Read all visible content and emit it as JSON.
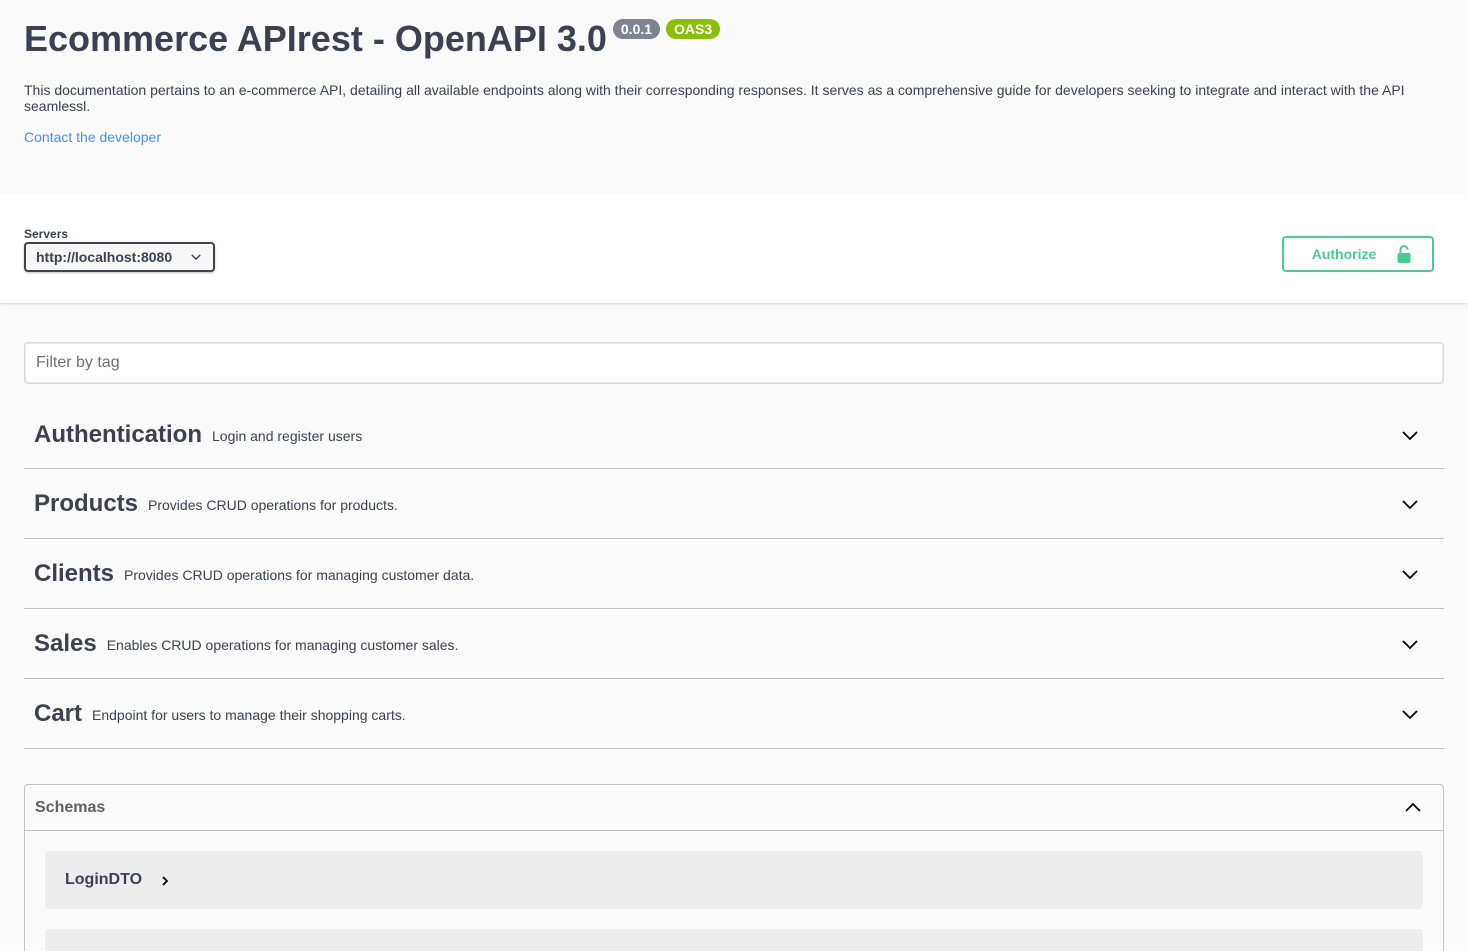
{
  "info": {
    "title": "Ecommerce APIrest - OpenAPI 3.0",
    "version": "0.0.1",
    "oas_badge": "OAS3",
    "description": "This documentation pertains to an e-commerce API, detailing all available endpoints along with their corresponding responses. It serves as a comprehensive guide for developers seeking to integrate and interact with the API seamlessl.",
    "contact_link": "Contact the developer"
  },
  "servers": {
    "label": "Servers",
    "selected": "http://localhost:8080"
  },
  "authorize": {
    "label": "Authorize",
    "icon": "lock-open-icon"
  },
  "filter": {
    "placeholder": "Filter by tag",
    "value": ""
  },
  "tags": [
    {
      "name": "Authentication",
      "description": "Login and register users"
    },
    {
      "name": "Products",
      "description": "Provides CRUD operations for products."
    },
    {
      "name": "Clients",
      "description": "Provides CRUD operations for managing customer data."
    },
    {
      "name": "Sales",
      "description": "Enables CRUD operations for managing customer sales."
    },
    {
      "name": "Cart",
      "description": "Endpoint for users to manage their shopping carts."
    }
  ],
  "schemas": {
    "title": "Schemas",
    "models": [
      {
        "name": "LoginDTO"
      },
      {
        "name": ""
      }
    ]
  },
  "colors": {
    "text": "#3b4151",
    "link": "#4990e2",
    "authorize": "#49cc90",
    "version_badge": "#7d8492",
    "oas_badge": "#89bf04",
    "background": "#fafafa"
  }
}
